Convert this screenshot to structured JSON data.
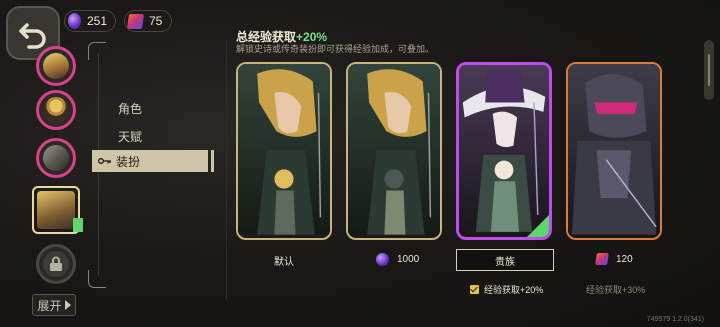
{
  "header": {
    "orb_amount": "251",
    "crystal_amount": "75"
  },
  "menu": {
    "items": [
      {
        "label": "角色"
      },
      {
        "label": "天赋"
      },
      {
        "label": "装扮"
      }
    ]
  },
  "sidebar": {
    "expand_label": "展开"
  },
  "outfits": {
    "title": "总经验获取",
    "title_bonus": "+20%",
    "subtitle": "解锁史诗或传奇装扮即可获得经验加成，可叠加。",
    "cards": [
      {
        "label": "默认"
      },
      {
        "price": "1000",
        "currency": "orb"
      },
      {
        "label": "贵族",
        "exp_bonus": "经验获取+20%",
        "checked": true
      },
      {
        "price": "120",
        "currency": "crystal",
        "exp_bonus": "经验获取+30%"
      }
    ]
  },
  "version": "749579 1.2.0(341)",
  "colors": {
    "accent_green": "#7be08a",
    "epic_purple": "#c04cf0",
    "legendary_orange": "#e07a3a",
    "gold_frame": "#c8b480"
  }
}
